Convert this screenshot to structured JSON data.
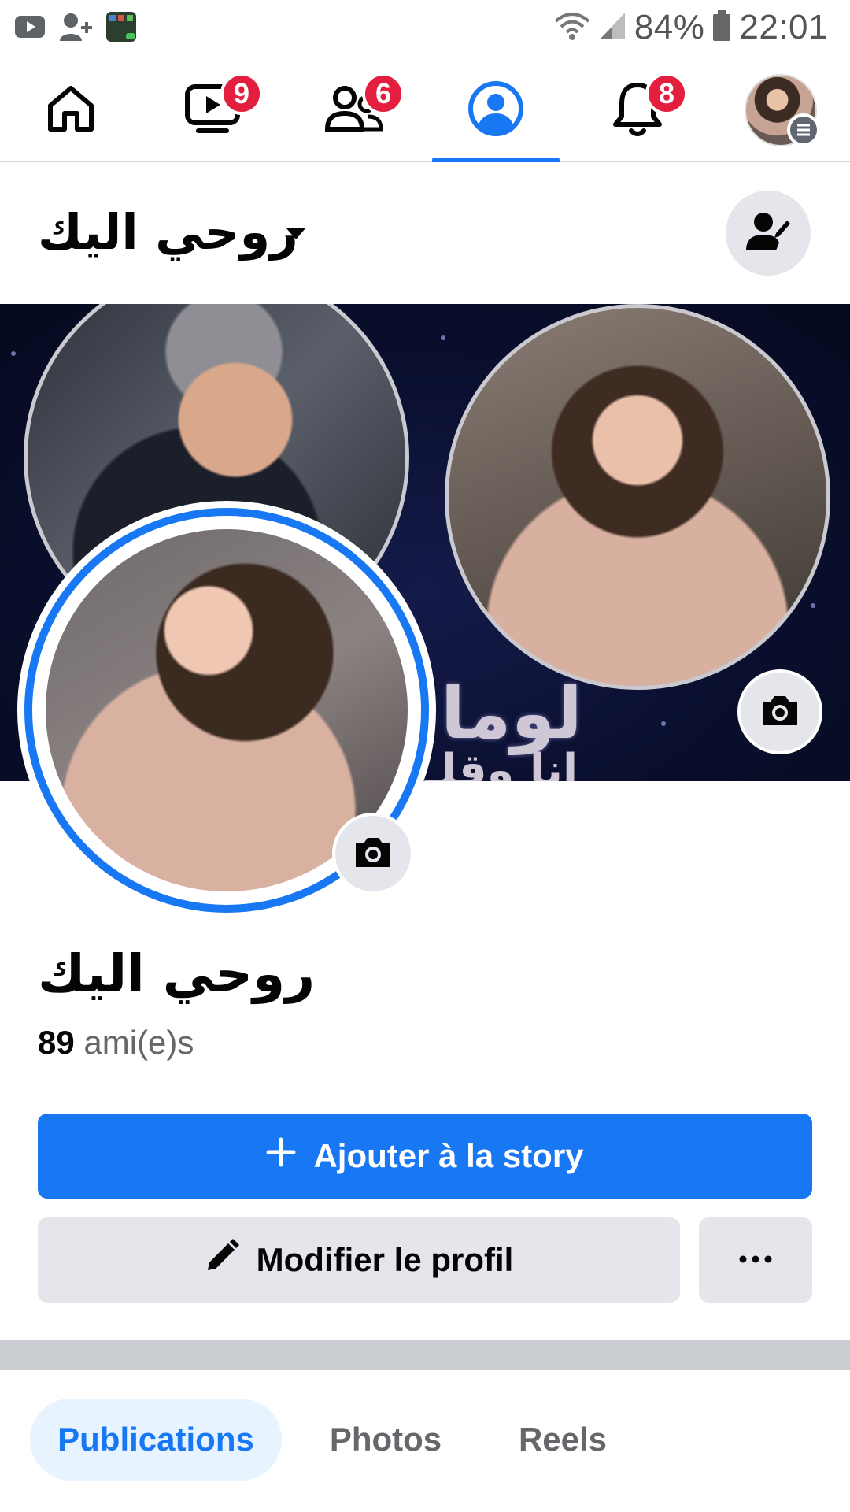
{
  "status_bar": {
    "battery": "84%",
    "time": "22:01",
    "icons": [
      "youtube-icon",
      "add-person-icon",
      "app-notification-icon",
      "wifi-icon",
      "signal-icon",
      "battery-icon"
    ]
  },
  "nav": {
    "items": [
      {
        "name": "home",
        "icon": "home-icon",
        "badge": ""
      },
      {
        "name": "watch",
        "icon": "video-icon",
        "badge": "9"
      },
      {
        "name": "friends",
        "icon": "friends-icon",
        "badge": "6"
      },
      {
        "name": "profile",
        "icon": "profile-icon",
        "badge": "",
        "active": true
      },
      {
        "name": "notifications",
        "icon": "bell-icon",
        "badge": "8"
      },
      {
        "name": "menu",
        "icon": "avatar-menu-icon",
        "badge": ""
      }
    ]
  },
  "profile": {
    "header_name": "روحي اليك",
    "name": "روحي اليك",
    "friends_count": "89",
    "friends_label": "ami(e)s",
    "cover_text": "لوما",
    "cover_text2": "انا وقلـ"
  },
  "buttons": {
    "story_label": "Ajouter à la story",
    "edit_label": "Modifier le profil",
    "more_label": "•••"
  },
  "tabs": [
    {
      "label": "Publications",
      "active": true
    },
    {
      "label": "Photos",
      "active": false
    },
    {
      "label": "Reels",
      "active": false
    }
  ],
  "colors": {
    "accent": "#1877f2",
    "badge": "#e41e3f",
    "button_grey": "#e4e6eb",
    "tab_active_bg": "#e7f3ff"
  }
}
